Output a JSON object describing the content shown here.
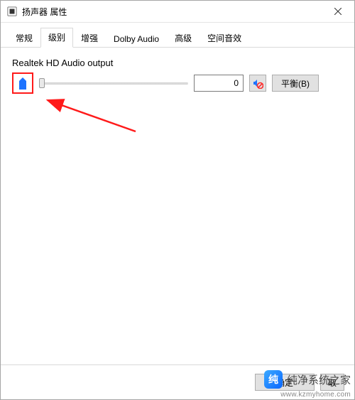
{
  "window": {
    "title": "扬声器 属性"
  },
  "tabs": [
    {
      "label": "常规",
      "active": false
    },
    {
      "label": "级别",
      "active": true
    },
    {
      "label": "增强",
      "active": false
    },
    {
      "label": "Dolby Audio",
      "active": false
    },
    {
      "label": "高级",
      "active": false
    },
    {
      "label": "空间音效",
      "active": false
    }
  ],
  "level": {
    "device_name": "Realtek HD Audio output",
    "value": "0",
    "balance_label": "平衡(B)",
    "icon_name": "speaker-icon",
    "mute_icon_name": "speaker-muted-icon"
  },
  "buttons": {
    "ok": "确定",
    "cancel_truncated": "取"
  },
  "watermark": {
    "brand": "纯净系统之家",
    "url": "www.kzmyhome.com"
  },
  "colors": {
    "highlight": "#ff1a1a",
    "accent": "#0a67ff"
  }
}
